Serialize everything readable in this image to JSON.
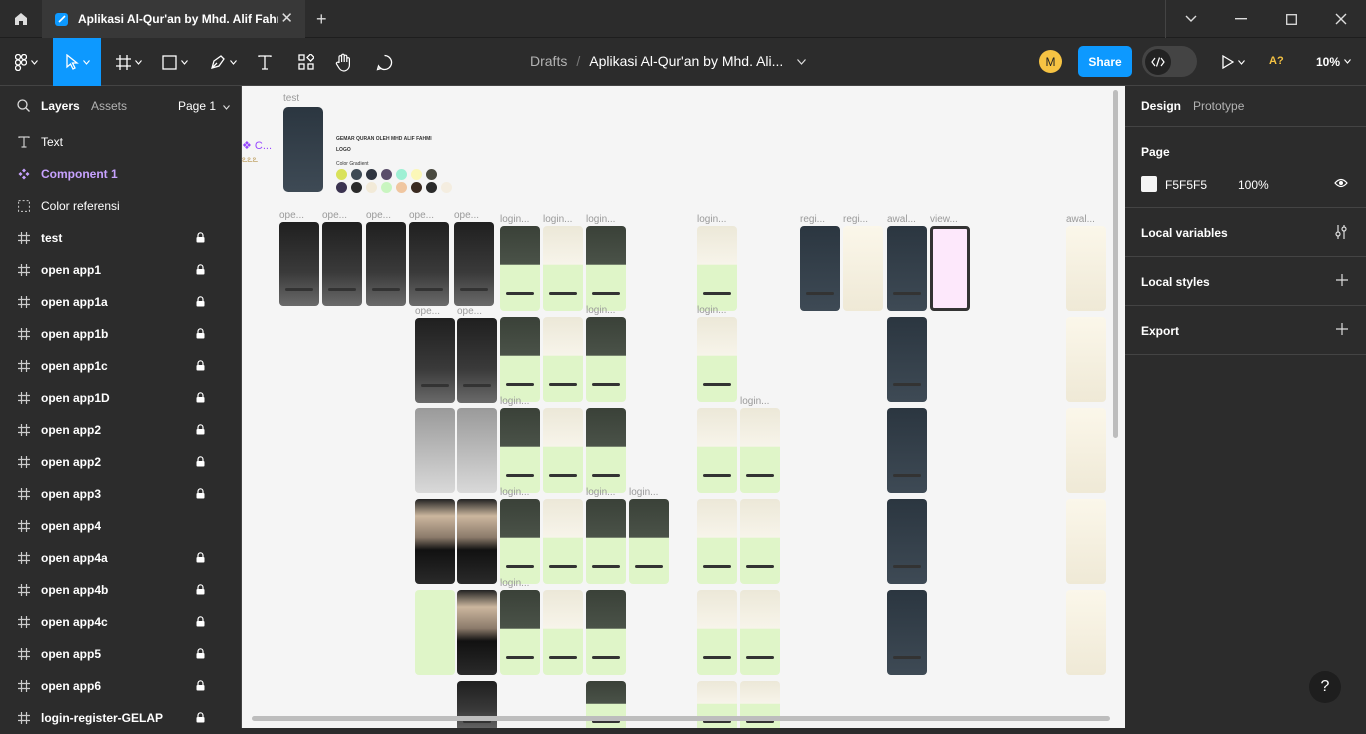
{
  "tab": {
    "title": "Aplikasi Al-Qur'an by Mhd. Alif Fahmi",
    "close": "✕",
    "new_tab": "+"
  },
  "header": {
    "crumb_root": "Drafts",
    "crumb_separator": "/",
    "crumb_file": "Aplikasi Al-Qur'an by Mhd. Ali...",
    "avatar_initial": "M",
    "share_label": "Share",
    "accessibility_label": "A?",
    "zoom": "10%"
  },
  "colors": {
    "accent": "#0d99ff",
    "component": "#c7a2ff",
    "avatar": "#f6c343",
    "canvas": "#F5F5F5"
  },
  "left_panel": {
    "tab_layers": "Layers",
    "tab_assets": "Assets",
    "page_label": "Page 1",
    "layers": [
      {
        "name": "Text",
        "icon": "text-icon",
        "locked": false
      },
      {
        "name": "Component 1",
        "icon": "component-icon",
        "locked": false
      },
      {
        "name": "Color referensi",
        "icon": "dashed-frame-icon",
        "locked": false
      },
      {
        "name": "test",
        "icon": "frame-icon",
        "locked": true
      },
      {
        "name": "open app1",
        "icon": "frame-icon",
        "locked": true
      },
      {
        "name": "open app1a",
        "icon": "frame-icon",
        "locked": true
      },
      {
        "name": "open app1b",
        "icon": "frame-icon",
        "locked": true
      },
      {
        "name": "open app1c",
        "icon": "frame-icon",
        "locked": true
      },
      {
        "name": "open app1D",
        "icon": "frame-icon",
        "locked": true
      },
      {
        "name": "open app2",
        "icon": "frame-icon",
        "locked": true
      },
      {
        "name": "open app2",
        "icon": "frame-icon",
        "locked": true
      },
      {
        "name": "open app3",
        "icon": "frame-icon",
        "locked": true
      },
      {
        "name": "open app4",
        "icon": "frame-icon",
        "locked": false
      },
      {
        "name": "open app4a",
        "icon": "frame-icon",
        "locked": true
      },
      {
        "name": "open app4b",
        "icon": "frame-icon",
        "locked": true
      },
      {
        "name": "open app4c",
        "icon": "frame-icon",
        "locked": true
      },
      {
        "name": "open app5",
        "icon": "frame-icon",
        "locked": true
      },
      {
        "name": "open app6",
        "icon": "frame-icon",
        "locked": true
      },
      {
        "name": "login-register-GELAP",
        "icon": "frame-icon",
        "locked": true
      }
    ]
  },
  "canvas": {
    "test_label": "test",
    "component_label": "C...",
    "title_text": "GEMAR QURAN OLEH MHD ALIF FAHMI",
    "logo_text": "LOGO",
    "gradient_text": "Color Gradient",
    "labels": {
      "ope": "ope...",
      "login": "login...",
      "regi": "regi...",
      "awal": "awal...",
      "view": "view..."
    }
  },
  "right_panel": {
    "tab_design": "Design",
    "tab_prototype": "Prototype",
    "page_title": "Page",
    "page_color": "F5F5F5",
    "page_opacity": "100%",
    "local_variables": "Local variables",
    "local_styles": "Local styles",
    "export": "Export"
  },
  "help_label": "?"
}
